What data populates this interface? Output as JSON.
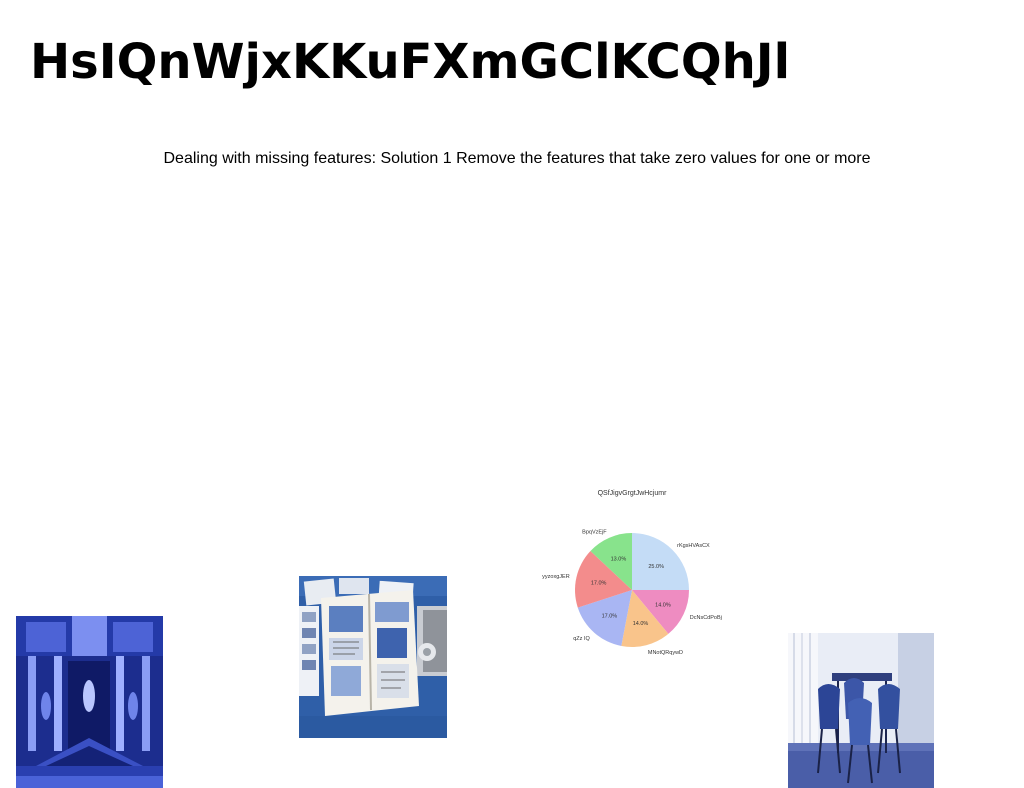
{
  "page": {
    "title": "HsIQnWjxKKuFXmGClKCQhJl",
    "subtitle": "Dealing with missing features: Solution 1 Remove the features that take zero values for one or more"
  },
  "images": [
    {
      "name": "temple-facade-photo",
      "palette": "blue"
    },
    {
      "name": "scrapbook-journal-photo",
      "palette": "blue"
    },
    {
      "name": "dining-chairs-photo",
      "palette": "blue"
    }
  ],
  "chart_data": {
    "type": "pie",
    "title": "QSfJigvGrgtJwHcjumr",
    "slices": [
      {
        "label": "rKgsHVAsCX",
        "value": 25.0,
        "pct_label": "25.0%",
        "color": "#c4dcf6"
      },
      {
        "label": "DcNsCdPoBj",
        "value": 14.0,
        "pct_label": "14.0%",
        "color": "#ee8cc1"
      },
      {
        "label": "MNotQRqywD",
        "value": 14.0,
        "pct_label": "14.0%",
        "color": "#f9c48b"
      },
      {
        "label": "qZz IQ",
        "value": 17.0,
        "pct_label": "17.0%",
        "color": "#a9b6f3"
      },
      {
        "label": "yyzoxgJER",
        "value": 17.0,
        "pct_label": "17.0%",
        "color": "#f38c8c"
      },
      {
        "label": "BpqVzEjF",
        "value": 13.0,
        "pct_label": "13.0%",
        "color": "#88e38c"
      }
    ],
    "start_angle_deg": 90,
    "direction": "clockwise",
    "legend": "none"
  }
}
